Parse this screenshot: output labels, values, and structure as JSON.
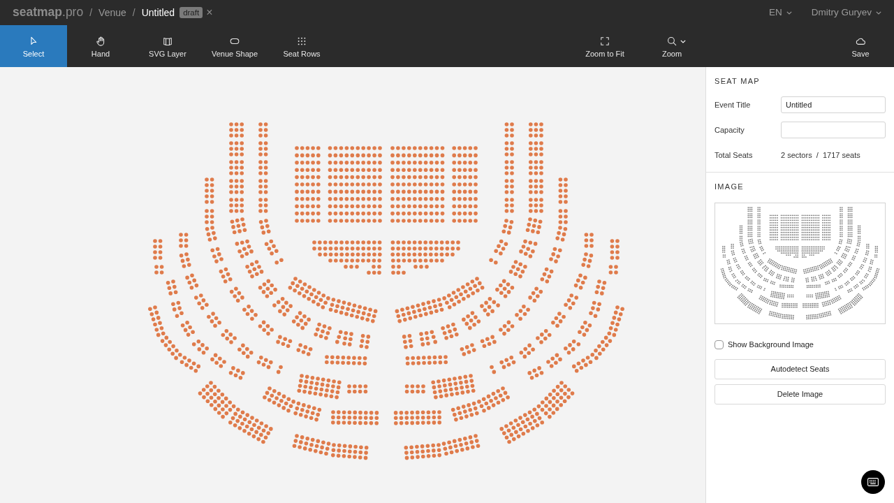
{
  "header": {
    "logo": "**seatmap**.pro",
    "breadcrumb": [
      {
        "separator": "/",
        "label": "Venue",
        "current": false
      },
      {
        "separator": "/",
        "label": "Untitled",
        "current": true
      }
    ],
    "badge": "draft",
    "close": "×",
    "language": "EN",
    "user": "Dmitry Guryev"
  },
  "toolbar": {
    "tools": [
      {
        "label": "Select",
        "selected": true
      },
      {
        "label": "Hand",
        "selected": false
      },
      {
        "label": "SVG Layer",
        "selected": false
      },
      {
        "label": "Venue Shape",
        "selected": false
      },
      {
        "label": "Seat Rows",
        "selected": false
      }
    ],
    "view_tools": [
      {
        "label": "Zoom to Fit",
        "menu": false
      },
      {
        "label": "Zoom",
        "menu": true
      }
    ],
    "save": {
      "label": "Save"
    }
  },
  "panel": {
    "seat_map": {
      "heading": "SEAT MAP",
      "rows": [
        {
          "kind": "input",
          "label": "Event Title",
          "value": "Untitled"
        },
        {
          "kind": "input",
          "label": "Capacity"
        },
        {
          "kind": "text",
          "label": "Total Seats",
          "value": "2 sectors  /  1717 seats"
        }
      ]
    },
    "image": {
      "heading": "IMAGE",
      "show_background": {
        "label": "Show Background Image",
        "checked": false
      },
      "buttons": [
        "Autodetect Seats",
        "Delete Image"
      ]
    }
  }
}
